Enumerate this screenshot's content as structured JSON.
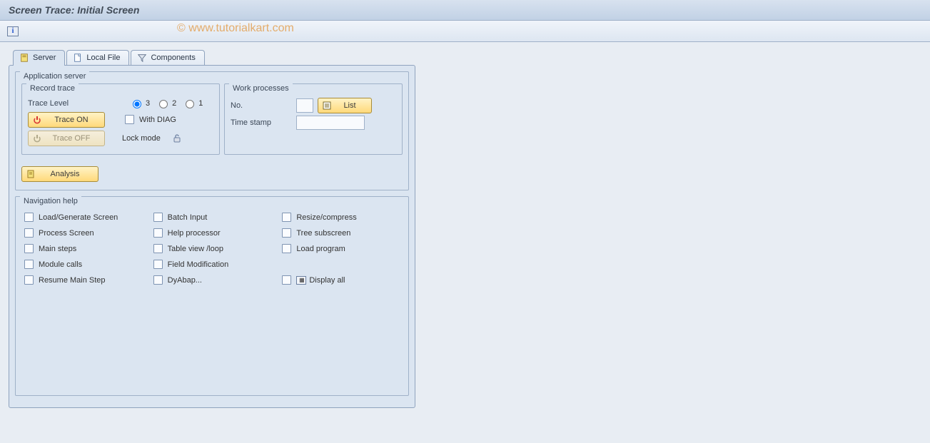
{
  "title": "Screen Trace: Initial Screen",
  "watermark": "© www.tutorialkart.com",
  "tabs": {
    "server": "Server",
    "localfile": "Local File",
    "components": "Components"
  },
  "appserver": {
    "legend": "Application server",
    "record": {
      "legend": "Record trace",
      "tracelevel_label": "Trace Level",
      "opt3": "3",
      "opt2": "2",
      "opt1": "1",
      "trace_on": "Trace ON",
      "trace_off": "Trace OFF",
      "with_diag": "With DIAG",
      "lock_mode": "Lock mode"
    },
    "work": {
      "legend": "Work processes",
      "no_label": "No.",
      "list_btn": "List",
      "timestamp_label": "Time stamp"
    },
    "analysis_btn": "Analysis"
  },
  "navhelp": {
    "legend": "Navigation help",
    "col1": {
      "c1": "Load/Generate Screen",
      "c2": "Process Screen",
      "c3": "Main steps",
      "c4": "Module calls",
      "c5": "Resume Main Step"
    },
    "col2": {
      "c1": "Batch Input",
      "c2": "Help processor",
      "c3": "Table view /loop",
      "c4": "Field Modification",
      "c5": "DyAbap..."
    },
    "col3": {
      "c1": "Resize/compress",
      "c2": "Tree subscreen",
      "c3": "Load program",
      "c5": "Display all"
    }
  }
}
